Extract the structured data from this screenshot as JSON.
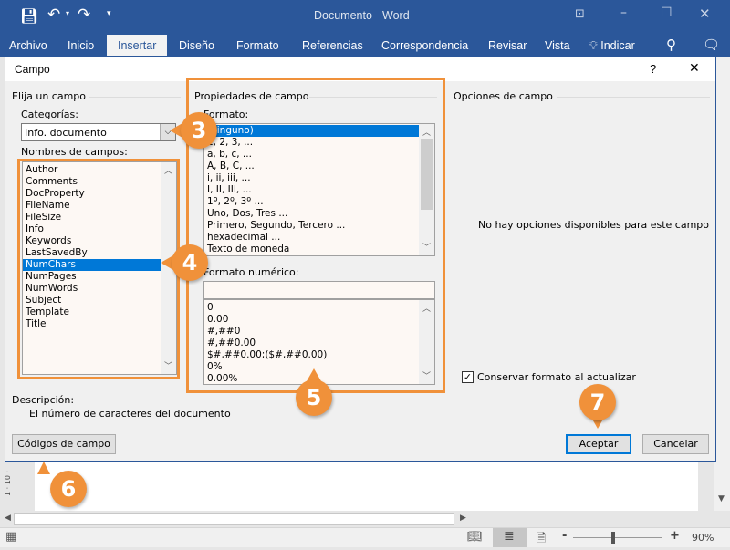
{
  "app": {
    "title": "Documento - Word",
    "qat": [
      "save-icon",
      "undo-icon",
      "redo-icon",
      "customize-icon"
    ],
    "window_controls": [
      "ribbon-display-icon",
      "minimize-icon",
      "maximize-icon",
      "close-icon"
    ],
    "accent": "#2b579a"
  },
  "ribbon": {
    "tabs": [
      "Archivo",
      "Inicio",
      "Insertar",
      "Diseño",
      "Formato",
      "Referencias",
      "Correspondencia",
      "Revisar",
      "Vista"
    ],
    "active_tab": "Insertar",
    "tell_me": "Indicar"
  },
  "dialog": {
    "title": "Campo",
    "help": "?",
    "close": "X",
    "left": {
      "group": "Elija un campo",
      "categories_label": "Categorías:",
      "category_value": "Info. documento",
      "names_label": "Nombres de campos:",
      "fields": [
        "Author",
        "Comments",
        "DocProperty",
        "FileName",
        "FileSize",
        "Info",
        "Keywords",
        "LastSavedBy",
        "NumChars",
        "NumPages",
        "NumWords",
        "Subject",
        "Template",
        "Title"
      ],
      "selected_field": "NumChars"
    },
    "middle": {
      "group": "Propiedades de campo",
      "format_label": "Formato:",
      "formats": [
        "(ninguno)",
        "1, 2, 3, ...",
        "a, b, c, ...",
        "A, B, C, ...",
        "i, ii, iii, ...",
        "I, II, III, ...",
        "1º, 2º, 3º ...",
        "Uno, Dos, Tres ...",
        "Primero, Segundo, Tercero ...",
        "hexadecimal ...",
        "Texto de moneda"
      ],
      "selected_format": "(ninguno)",
      "numeric_label": "Formato numérico:",
      "numeric_value": "",
      "numeric_formats": [
        "0",
        "0.00",
        "#,##0",
        "#,##0.00",
        "$#,##0.00;($#,##0.00)",
        "0%",
        "0.00%"
      ]
    },
    "right": {
      "group": "Opciones de campo",
      "empty_message": "No hay opciones disponibles para este campo",
      "preserve_label": "Conservar formato al actualizar",
      "preserve_checked": true
    },
    "description_label": "Descripción:",
    "description": "El número de caracteres del documento",
    "codes_button": "Códigos de campo",
    "ok_button": "Aceptar",
    "cancel_button": "Cancelar"
  },
  "callouts": [
    "3",
    "4",
    "5",
    "6",
    "7"
  ],
  "callout_color": "#f0913a",
  "ruler": {
    "label": "1 · 10 ·"
  },
  "status": {
    "zoom": "90%",
    "zoom_minus": "-",
    "zoom_plus": "+",
    "zoom_percent": 90
  }
}
